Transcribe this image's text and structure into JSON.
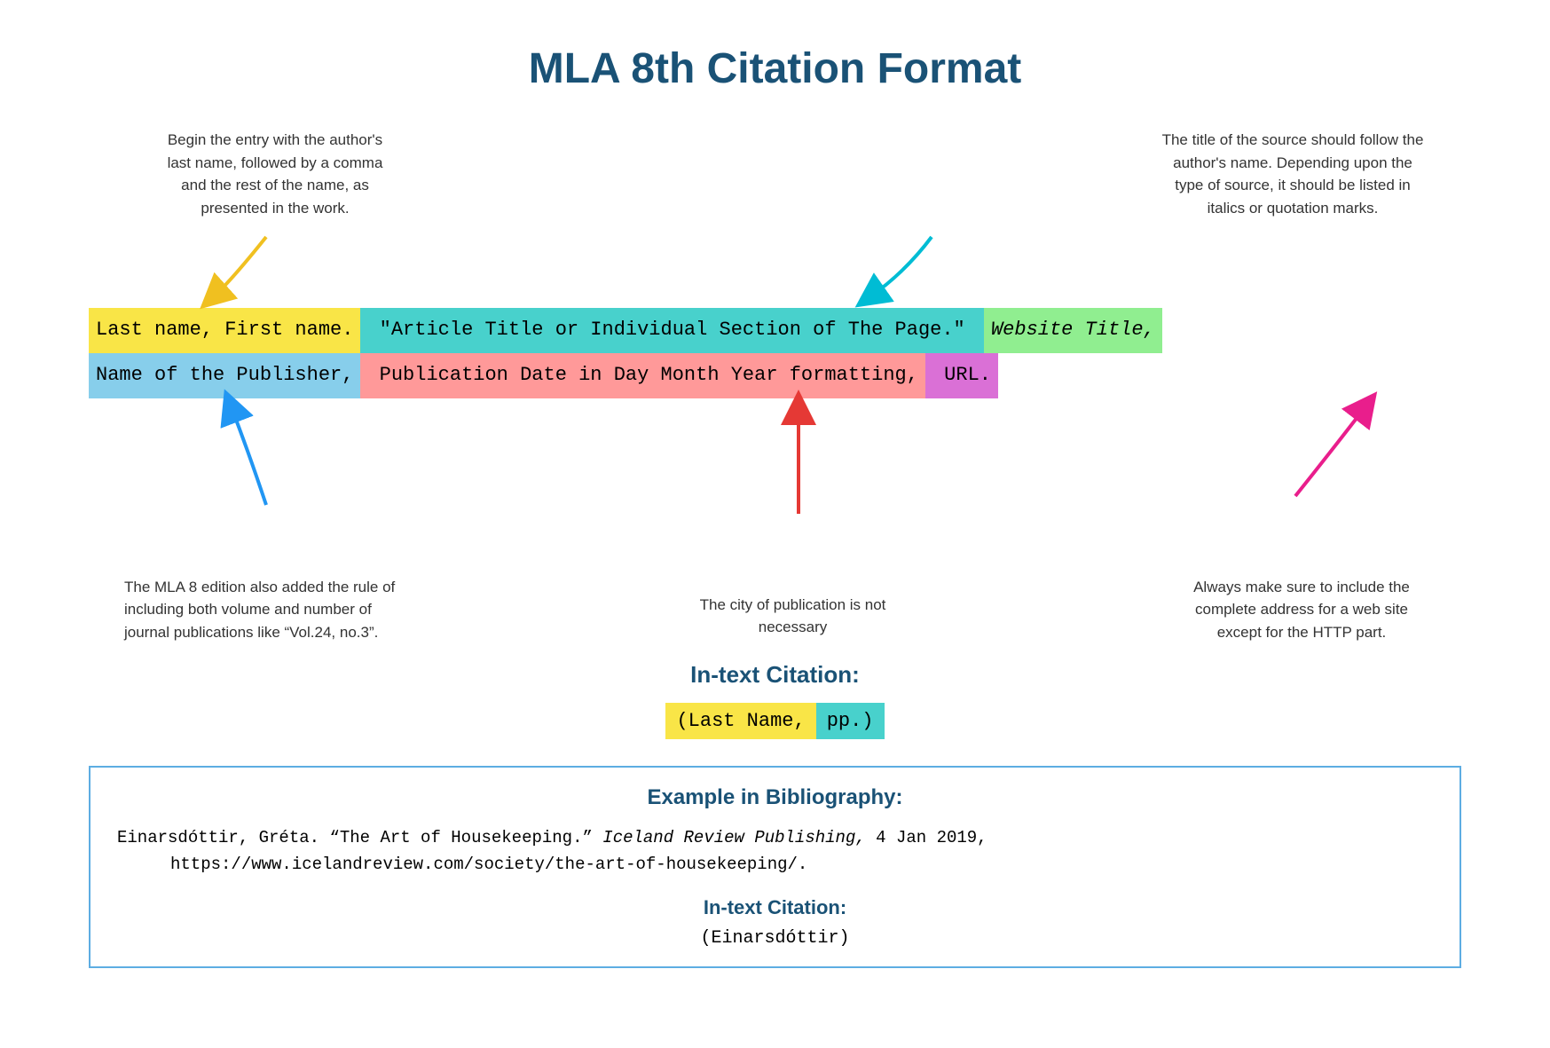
{
  "title": "MLA 8th Citation Format",
  "annotation_left": "Begin the entry with the author's last name, followed by a comma and the rest of the name, as presented in the work.",
  "annotation_right": "The title of the source should follow the author's name. Depending upon the type of source, it should be listed in italics or quotation marks.",
  "citation_line1": [
    {
      "text": "Last name, First name.",
      "class": "seg-yellow"
    },
    {
      "text": " “Article Title or Individual Section of The Page.” ",
      "class": "seg-cyan"
    },
    {
      "text": "Website Title,",
      "class": "seg-green"
    }
  ],
  "citation_line2": [
    {
      "text": "Name of the Publisher,",
      "class": "seg-blue"
    },
    {
      "text": " Publication Date in Day Month Year formatting,",
      "class": "seg-pink"
    },
    {
      "text": " URL.",
      "class": "seg-magenta"
    }
  ],
  "bottom_left": "The MLA 8 edition also added the rule of including both volume and number of journal publications like “Vol.24, no.3”.",
  "bottom_center": "The city of publication is not necessary",
  "bottom_right": "Always make sure to include the complete address for a web site except for the HTTP part.",
  "intext_citation_label": "In-text Citation:",
  "intext_citation_value_part1": "(Last Name,",
  "intext_citation_value_part2": "pp.)",
  "example_section": {
    "title": "Example in Bibliography:",
    "bib_line1": "Einarsdóttir, Gréta. “The Art of Housekeeping.” ",
    "bib_italic": "Iceland Review Publishing,",
    "bib_line1_end": " 4 Jan 2019,",
    "bib_line2": "https://www.icelandreview.com/society/the-art-of-housekeeping/.",
    "intext_title": "In-text Citation:",
    "intext_value": "(Einarsdóttir)"
  }
}
